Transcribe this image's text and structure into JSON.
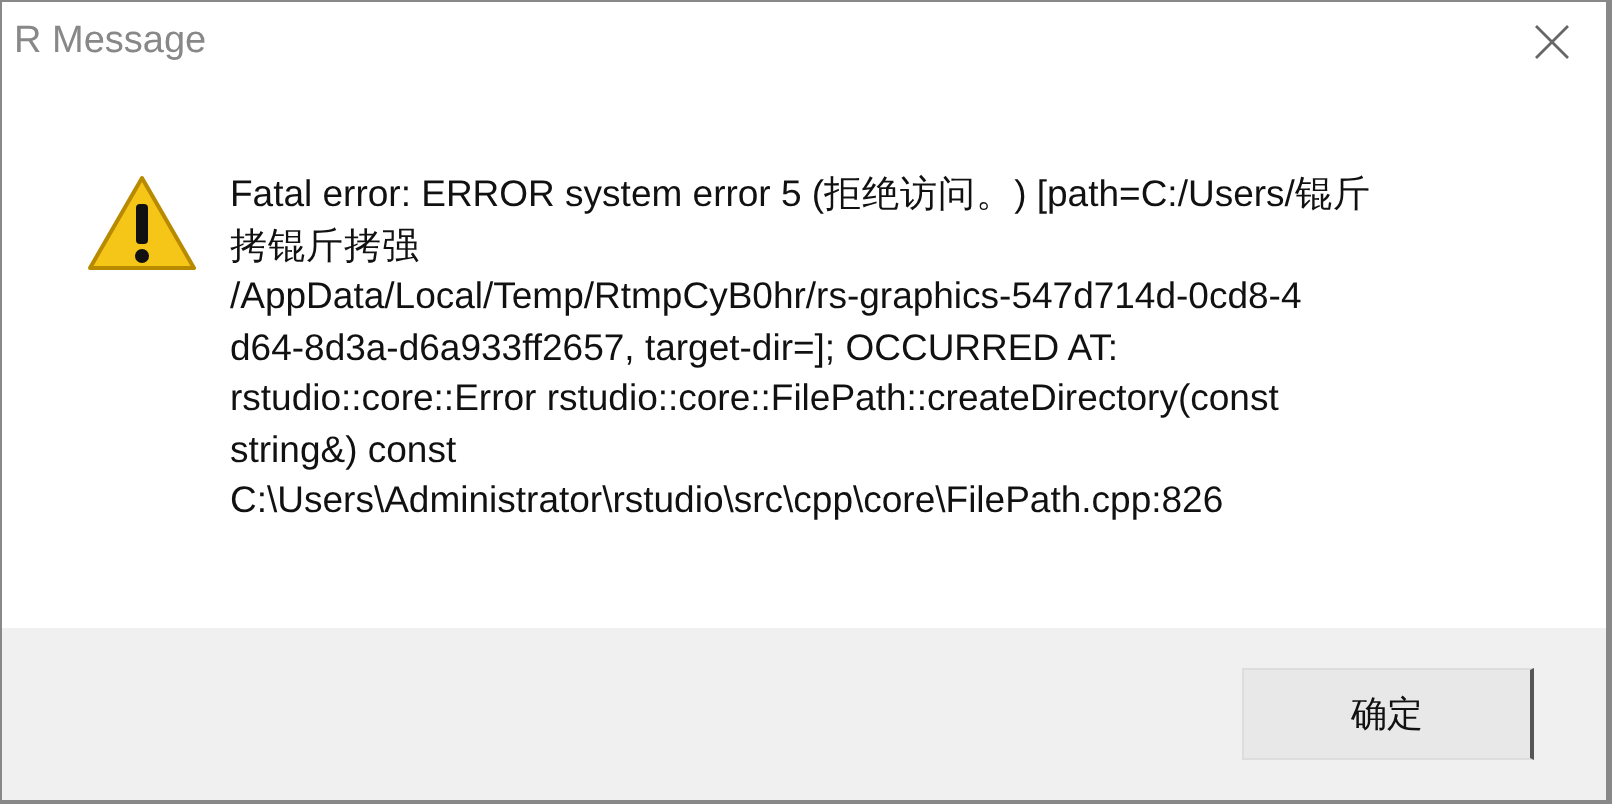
{
  "window": {
    "title": "R Message"
  },
  "message_lines": [
    "Fatal error: ERROR system error 5 (拒绝访问。) [path=C:/Users/锟斤",
    "拷锟斤拷强",
    "/AppData/Local/Temp/RtmpCyB0hr/rs-graphics-547d714d-0cd8-4",
    "d64-8d3a-d6a933ff2657, target-dir=]; OCCURRED AT:",
    "rstudio::core::Error rstudio::core::FilePath::createDirectory(const",
    "string&) const",
    "C:\\Users\\Administrator\\rstudio\\src\\cpp\\core\\FilePath.cpp:826"
  ],
  "buttons": [
    "确定"
  ]
}
